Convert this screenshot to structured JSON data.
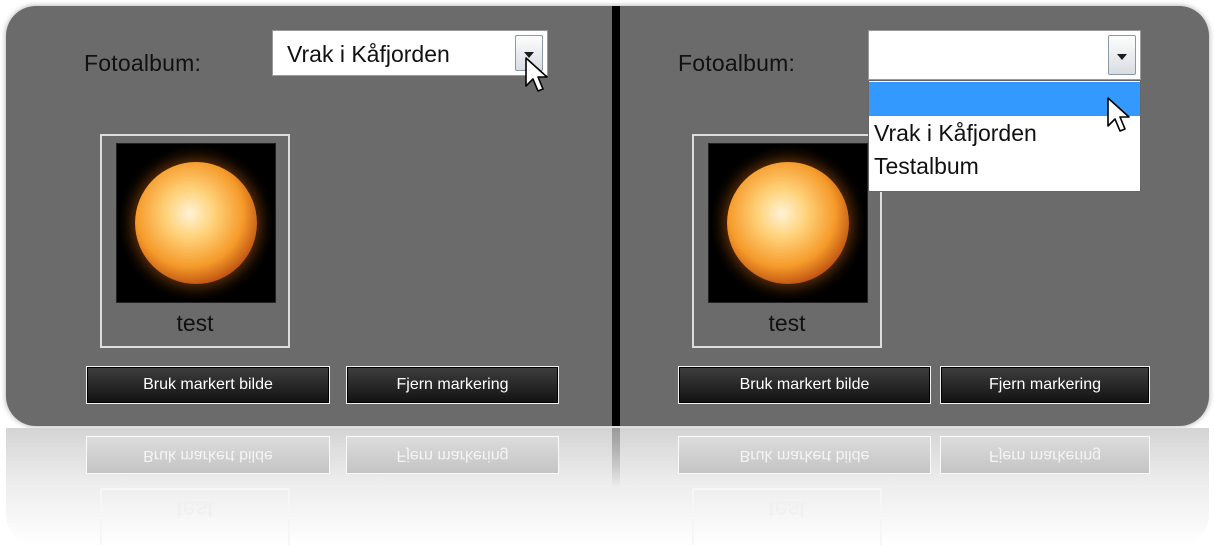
{
  "panels": [
    {
      "label": "Fotoalbum:",
      "select_value": "Vrak i Kåfjorden",
      "dropdown_open": false,
      "thumbnail_caption": "test",
      "buttons": {
        "use": "Bruk markert bilde",
        "clear": "Fjern markering"
      }
    },
    {
      "label": "Fotoalbum:",
      "select_value": "",
      "dropdown_open": true,
      "dropdown_options": [
        "",
        "Vrak i Kåfjorden",
        "Testalbum"
      ],
      "thumbnail_caption": "test",
      "buttons": {
        "use": "Bruk markert bilde",
        "clear": "Fjern markering"
      }
    }
  ],
  "reflection": {
    "use": "Bruk markert bilde",
    "clear": "Fjern markering",
    "caption": "test"
  },
  "colors": {
    "panel_bg": "#6b6b6b",
    "divider": "#000000",
    "dropdown_highlight": "#3399ff",
    "button_bg": "#1e1e1e"
  }
}
